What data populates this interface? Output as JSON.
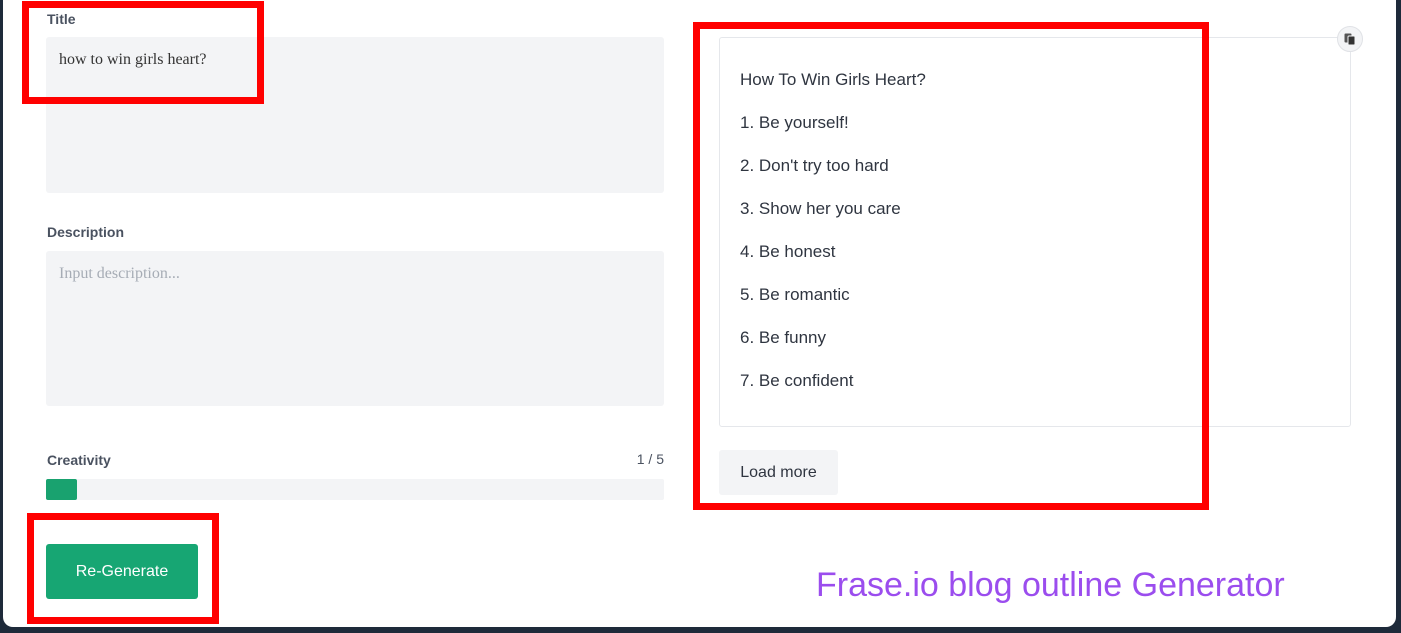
{
  "form": {
    "title_label": "Title",
    "title_value": "how to win girls heart?",
    "description_label": "Description",
    "description_placeholder": "Input description...",
    "creativity_label": "Creativity",
    "creativity_value": "1 / 5",
    "creativity_level": 0.05,
    "regenerate_label": "Re-Generate"
  },
  "output": {
    "lines": [
      "How To Win Girls Heart?",
      "1. Be yourself!",
      "2. Don't try too hard",
      "3. Show her you care",
      "4. Be honest",
      "5. Be romantic",
      "6. Be funny",
      "7. Be confident"
    ],
    "copy_icon": "copy-icon",
    "load_more_label": "Load more"
  },
  "watermark": "Frase.io blog outline Generator",
  "colors": {
    "accent": "#17a673",
    "highlight": "#ff0000",
    "watermark": "#9b4dee"
  }
}
